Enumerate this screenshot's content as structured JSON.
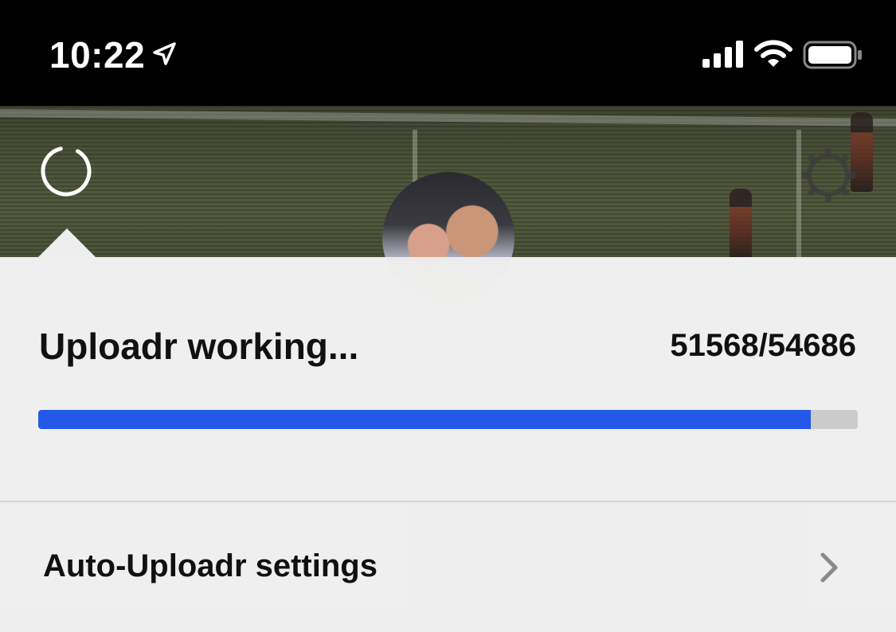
{
  "status_bar": {
    "time": "10:22",
    "location_icon": "location-arrow-icon",
    "signal_icon": "cellular-signal-icon",
    "wifi_icon": "wifi-icon",
    "battery_icon": "battery-icon"
  },
  "header": {
    "spinner_icon": "loading-spinner-icon",
    "settings_icon": "gear-icon",
    "avatar": "profile-avatar"
  },
  "uploader": {
    "title": "Uploadr working...",
    "count": "51568/54686",
    "progress": {
      "done": 51568,
      "total": 54686,
      "fill_color": "#2458e8",
      "track_color": "#cbcbcb"
    }
  },
  "settings_row": {
    "label": "Auto-Uploadr settings",
    "chevron_icon": "chevron-right-icon"
  }
}
